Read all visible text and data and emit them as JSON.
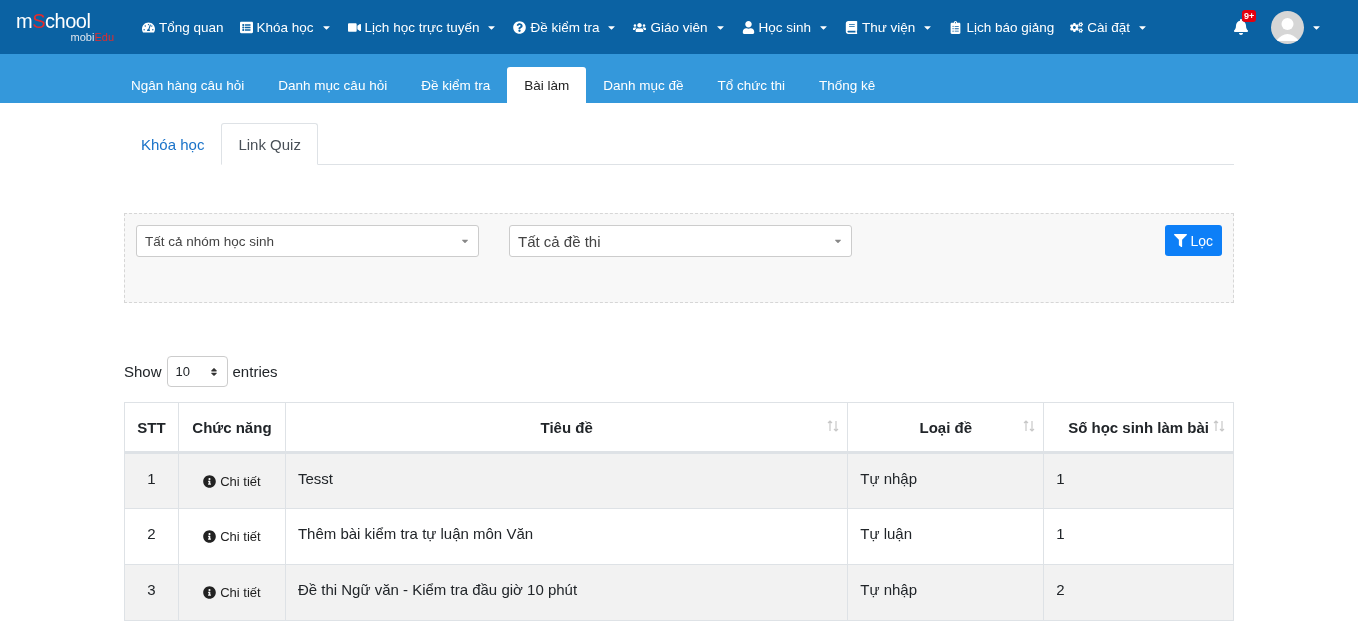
{
  "logo": {
    "parts": [
      {
        "text": "m",
        "accent": false
      },
      {
        "text": "S",
        "accent": true
      },
      {
        "text": "chool",
        "accent": false
      }
    ],
    "subtitle_parts": [
      {
        "text": "mobi",
        "accent": false
      },
      {
        "text": "Edu",
        "accent": true
      }
    ]
  },
  "nav": [
    {
      "label": "Tổng quan",
      "dropdown": false
    },
    {
      "label": "Khóa học",
      "dropdown": true
    },
    {
      "label": "Lịch học trực tuyến",
      "dropdown": true
    },
    {
      "label": "Đề kiểm tra",
      "dropdown": true
    },
    {
      "label": "Giáo viên",
      "dropdown": true
    },
    {
      "label": "Học sinh",
      "dropdown": true
    },
    {
      "label": "Thư viện",
      "dropdown": true
    },
    {
      "label": "Lịch báo giảng",
      "dropdown": false
    },
    {
      "label": "Cài đặt",
      "dropdown": true
    }
  ],
  "notifications": {
    "badge": "9+"
  },
  "tabs": [
    {
      "label": "Ngân hàng câu hỏi",
      "selected": false
    },
    {
      "label": "Danh mục câu hỏi",
      "selected": false
    },
    {
      "label": "Đề kiểm tra",
      "selected": false
    },
    {
      "label": "Bài làm",
      "selected": true
    },
    {
      "label": "Danh mục đề",
      "selected": false
    },
    {
      "label": "Tổ chức thi",
      "selected": false
    },
    {
      "label": "Thống kê",
      "selected": false
    }
  ],
  "subtabs": [
    {
      "label": "Khóa học",
      "selected": false
    },
    {
      "label": "Link Quiz",
      "selected": true
    }
  ],
  "filters": {
    "selects": [
      {
        "value": "Tất cả nhóm học sinh"
      },
      {
        "value": "Tất cả đề thi"
      }
    ],
    "button": "Lọc"
  },
  "length": {
    "show": "Show",
    "value": "10",
    "entries": "entries"
  },
  "table": {
    "columns": [
      {
        "label": "STT",
        "sortable": false
      },
      {
        "label": "Chức năng",
        "sortable": false
      },
      {
        "label": "Tiêu đề",
        "sortable": true
      },
      {
        "label": "Loại đề",
        "sortable": true
      },
      {
        "label": "Số học sinh làm bài",
        "sortable": true
      }
    ],
    "rows": [
      {
        "stt": "1",
        "action": "Chi tiết",
        "title": "Tesst",
        "type": "Tự nhập",
        "count": "1"
      },
      {
        "stt": "2",
        "action": "Chi tiết",
        "title": "Thêm bài kiểm tra tự luận môn Văn",
        "type": "Tự luận",
        "count": "1"
      },
      {
        "stt": "3",
        "action": "Chi tiết",
        "title": "Đề thi Ngữ văn - Kiểm tra đầu giờ 10 phút",
        "type": "Tự nhập",
        "count": "2"
      }
    ]
  }
}
